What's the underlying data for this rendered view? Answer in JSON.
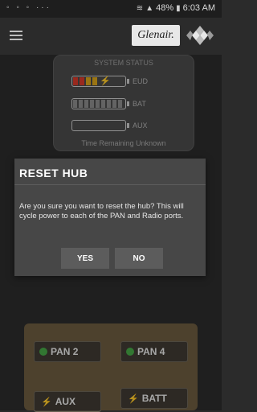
{
  "status_bar": {
    "left_icons": "◦ ◦ ◦ ···",
    "battery_percent": "48%",
    "time": "6:03 AM"
  },
  "header": {
    "logo_text": "Glenair."
  },
  "system_status": {
    "title": "SYSTEM STATUS",
    "rows": [
      {
        "label": "EUD",
        "level": 0.4,
        "color": "#d43a2a"
      },
      {
        "label": "BAT",
        "level": 0.0
      },
      {
        "label": "AUX",
        "level": 0.0
      }
    ],
    "time_remaining": "Time Remaining Unknown"
  },
  "dialog": {
    "title": "RESET HUB",
    "message": "Are you sure you want to reset the hub? This will cycle power to each of the PAN and Radio ports.",
    "yes_label": "YES",
    "no_label": "NO"
  },
  "ports": {
    "pan2": "PAN 2",
    "pan4": "PAN 4",
    "aux": "AUX",
    "batt": "BATT"
  },
  "colors": {
    "accent_green": "#46a546",
    "battery_red": "#d43a2a",
    "battery_yellow": "#d7a21b"
  }
}
